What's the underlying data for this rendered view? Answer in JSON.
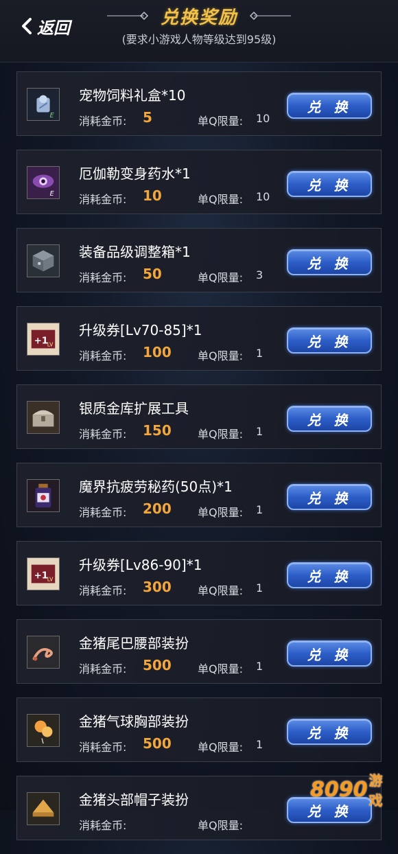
{
  "header": {
    "back_label": "返回",
    "title": "兑换奖励",
    "subtitle": "(要求小游戏人物等级达到95级)"
  },
  "labels": {
    "cost": "消耗金币:",
    "limit": "单Q限量:",
    "exchange": "兑 换"
  },
  "items": [
    {
      "name": "宠物饲料礼盒*10",
      "cost": "5",
      "limit": "10",
      "icon": "pet-food-box-icon"
    },
    {
      "name": "厄伽勒变身药水*1",
      "cost": "10",
      "limit": "10",
      "icon": "potion-eye-icon"
    },
    {
      "name": "装备品级调整箱*1",
      "cost": "50",
      "limit": "3",
      "icon": "equipment-grade-box-icon"
    },
    {
      "name": "升级券[Lv70-85]*1",
      "cost": "100",
      "limit": "1",
      "icon": "level-up-ticket-icon"
    },
    {
      "name": "银质金库扩展工具",
      "cost": "150",
      "limit": "1",
      "icon": "treasure-chest-icon"
    },
    {
      "name": "魔界抗疲劳秘药(50点)*1",
      "cost": "200",
      "limit": "1",
      "icon": "fatigue-potion-icon"
    },
    {
      "name": "升级券[Lv86-90]*1",
      "cost": "300",
      "limit": "1",
      "icon": "level-up-ticket-icon"
    },
    {
      "name": "金猪尾巴腰部装扮",
      "cost": "500",
      "limit": "1",
      "icon": "pig-tail-icon"
    },
    {
      "name": "金猪气球胸部装扮",
      "cost": "500",
      "limit": "1",
      "icon": "pig-balloon-icon"
    },
    {
      "name": "金猪头部帽子装扮",
      "cost": "",
      "limit": "",
      "icon": "pig-hat-icon"
    }
  ],
  "watermark": {
    "number": "8090",
    "text": "游戏"
  },
  "colors": {
    "title_gold": "#f2c14a",
    "cost_orange": "#f2a63b",
    "button_blue": "#2d5ec8",
    "watermark_orange": "#f59a23"
  }
}
